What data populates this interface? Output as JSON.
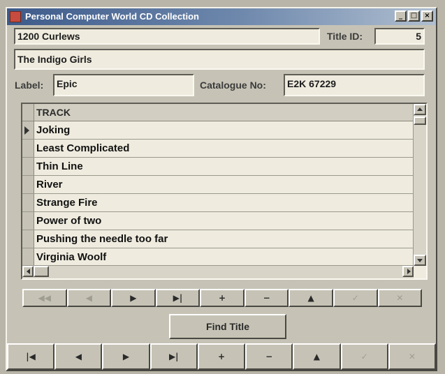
{
  "window": {
    "title": "Personal Computer World CD Collection",
    "controls": {
      "minimize": "_",
      "maximize": "□",
      "close": "×"
    }
  },
  "form": {
    "album_title": "1200 Curlews",
    "title_id_label": "Title ID:",
    "title_id_value": "5",
    "artist": "The Indigo Girls",
    "label_label": "Label:",
    "label_value": "Epic",
    "catalogue_label": "Catalogue No:",
    "catalogue_value": "E2K 67229"
  },
  "tracks": {
    "column_header": "TRACK",
    "rows": [
      "Joking",
      "Least Complicated",
      "Thin Line",
      "River",
      "Strange Fire",
      "Power of two",
      "Pushing the needle too far",
      "Virginia Woolf"
    ],
    "current_row": 0
  },
  "grid_nav": {
    "buttons": [
      {
        "name": "first",
        "glyph": "◀◀",
        "enabled": false
      },
      {
        "name": "prev",
        "glyph": "◀",
        "enabled": false
      },
      {
        "name": "next",
        "glyph": "▶",
        "enabled": true
      },
      {
        "name": "last",
        "glyph": "▶|",
        "enabled": true
      },
      {
        "name": "insert",
        "glyph": "+",
        "enabled": true
      },
      {
        "name": "delete",
        "glyph": "−",
        "enabled": true
      },
      {
        "name": "edit",
        "glyph": "▲",
        "enabled": true
      },
      {
        "name": "post",
        "glyph": "✓",
        "enabled": false
      },
      {
        "name": "cancel",
        "glyph": "✕",
        "enabled": false
      }
    ]
  },
  "find_button": "Find Title",
  "main_nav": {
    "buttons": [
      {
        "name": "first",
        "glyph": "|◀",
        "enabled": true
      },
      {
        "name": "prev",
        "glyph": "◀",
        "enabled": true
      },
      {
        "name": "next",
        "glyph": "▶",
        "enabled": true
      },
      {
        "name": "last",
        "glyph": "▶|",
        "enabled": true
      },
      {
        "name": "insert",
        "glyph": "+",
        "enabled": true
      },
      {
        "name": "delete",
        "glyph": "−",
        "enabled": true
      },
      {
        "name": "edit",
        "glyph": "▲",
        "enabled": true
      },
      {
        "name": "post",
        "glyph": "✓",
        "enabled": false
      },
      {
        "name": "cancel",
        "glyph": "✕",
        "enabled": false
      }
    ]
  },
  "colors": {
    "title_bar_start": "#3d5a8a",
    "window_face": "#c6c3b6",
    "field_background": "#efecdf"
  }
}
